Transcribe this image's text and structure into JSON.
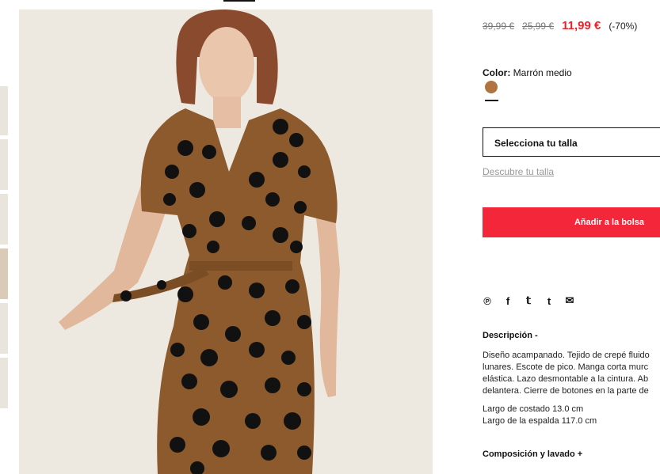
{
  "price": {
    "original": "39,99 €",
    "previous": "25,99 €",
    "current": "11,99 €",
    "discount": "(-70%)"
  },
  "color": {
    "label": "Color:",
    "value": "Marrón medio",
    "swatch_hex": "#b07440"
  },
  "size": {
    "select_label": "Selecciona tu talla",
    "guide_link": "Descubre tu talla"
  },
  "cart": {
    "add_label": "Añadir a la bolsa",
    "accent": "#f4273a"
  },
  "share": {
    "icons": [
      "pinterest-icon",
      "facebook-icon",
      "twitter-icon",
      "tumblr-icon",
      "email-icon"
    ],
    "glyphs": [
      "℗",
      "f",
      "𝕥",
      "t",
      "✉"
    ]
  },
  "description": {
    "title": "Descripción -",
    "lines": [
      "Diseño acampanado. Tejido de crepé fluido",
      "lunares. Escote de pico. Manga corta murc",
      "elástica. Lazo desmontable a la cintura. Ab",
      "delantera. Cierre de botones en la parte de"
    ],
    "measures": [
      "Largo de costado 13.0 cm",
      "Largo de la espalda 117.0 cm"
    ]
  },
  "composition": {
    "title": "Composición y lavado +"
  }
}
